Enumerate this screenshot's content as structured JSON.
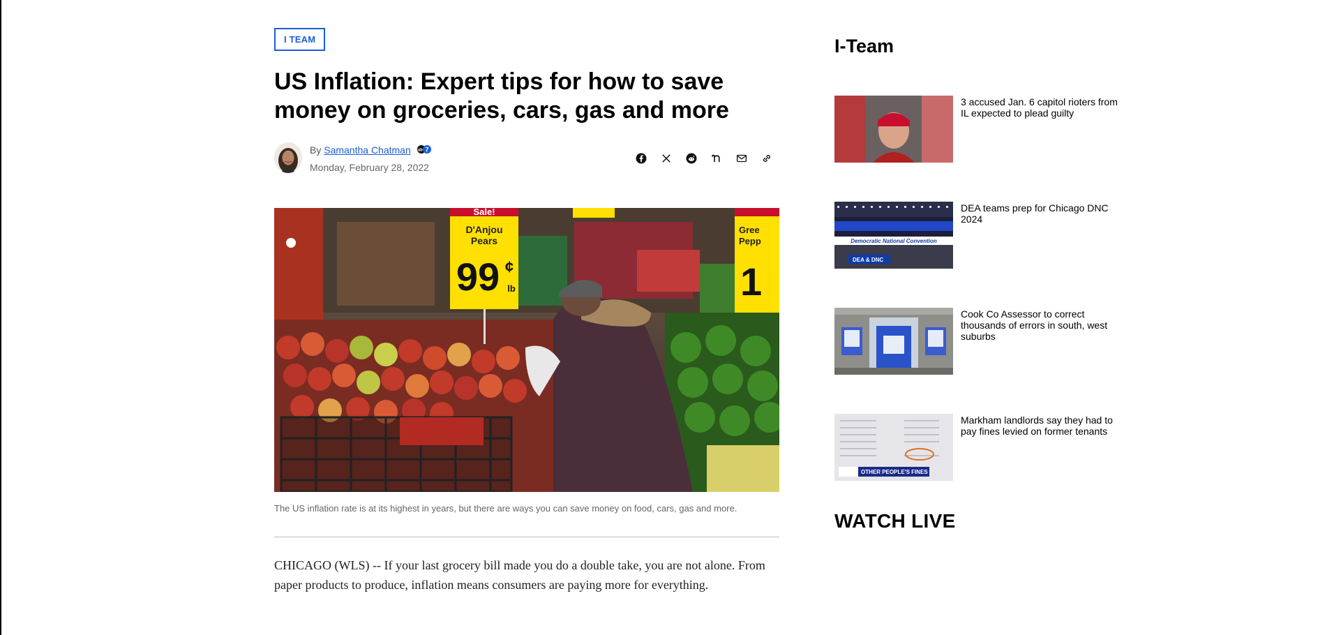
{
  "article": {
    "section_tag": "I TEAM",
    "headline": "US Inflation: Expert tips for how to save money on groceries, cars, gas and more",
    "byline_prefix": "By",
    "author": "Samantha Chatman",
    "date": "Monday, February 28, 2022",
    "share_icons": [
      "facebook-icon",
      "x-icon",
      "reddit-icon",
      "nextdoor-icon",
      "email-icon",
      "link-icon"
    ],
    "hero_signs": {
      "sale": "Sale!",
      "product": "D'Anjou",
      "product2": "Pears",
      "price": "99",
      "cents": "¢",
      "unit": "lb",
      "right_sign": "Gree",
      "right_sign2": "Pepp",
      "right_price": "1"
    },
    "caption": "The US inflation rate is at its highest in years, but there are ways you can save money on food, cars, gas and more.",
    "body_paragraph": "CHICAGO (WLS) -- If your last grocery bill made you do a double take, you are not alone. From paper products to produce, inflation means consumers are paying more for everything."
  },
  "sidebar": {
    "title": "I-Team",
    "stories": [
      {
        "title": "3 accused Jan. 6 capitol rioters from IL expected to plead guilty"
      },
      {
        "title": "DEA teams prep for Chicago DNC 2024",
        "thumb_banner": "Democratic National Convention",
        "thumb_tag": "DEA & DNC"
      },
      {
        "title": "Cook Co Assessor to correct thousands of errors in south, west suburbs"
      },
      {
        "title": "Markham landlords say they had to pay fines levied on former tenants",
        "thumb_tag": "OTHER PEOPLE'S FINES"
      }
    ]
  },
  "watch_live": "WATCH LIVE",
  "colors": {
    "accent": "#1a5dd9",
    "text": "#000000",
    "muted": "#666666",
    "sign_yellow": "#ffe000"
  }
}
